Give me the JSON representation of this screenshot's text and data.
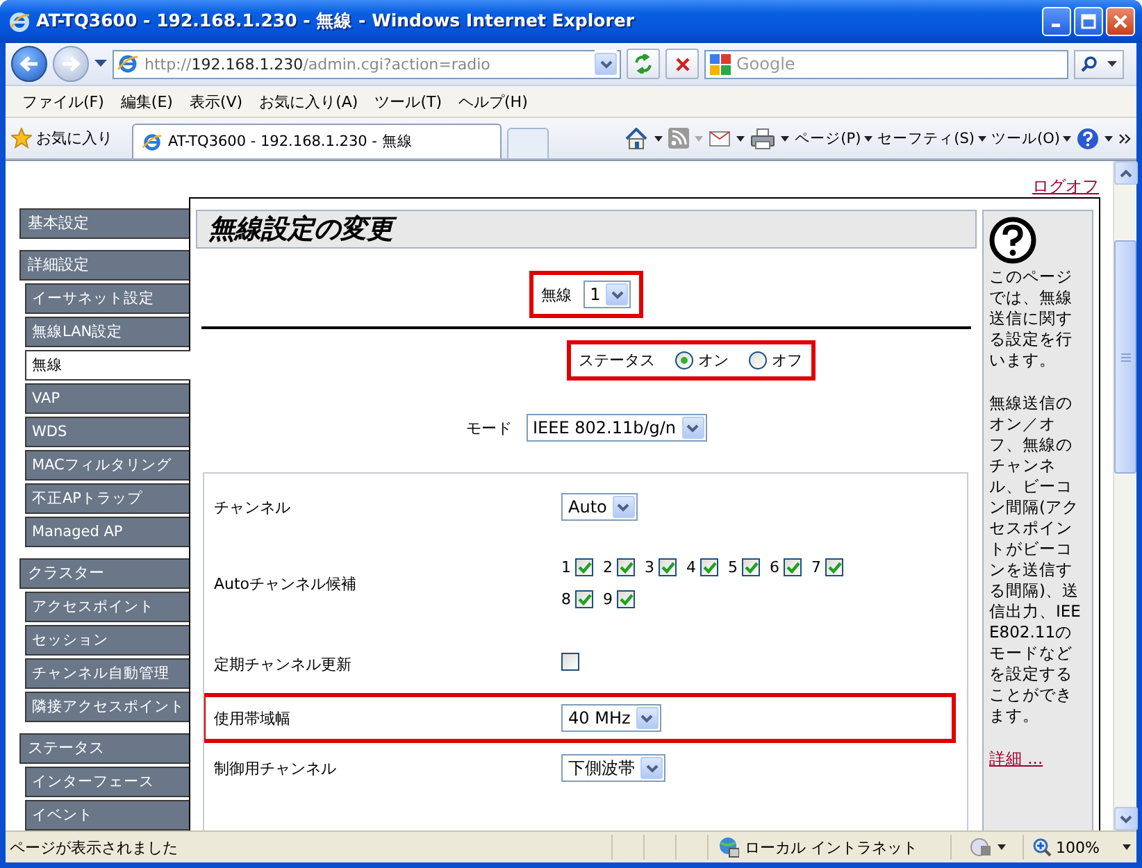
{
  "window": {
    "title": "AT-TQ3600 - 192.168.1.230 - 無線 - Windows Internet Explorer"
  },
  "address_bar": {
    "scheme": "http://",
    "host": "192.168.1.230",
    "path": "/admin.cgi?action=radio"
  },
  "search": {
    "placeholder": "Google"
  },
  "menu": [
    "ファイル(F)",
    "編集(E)",
    "表示(V)",
    "お気に入り(A)",
    "ツール(T)",
    "ヘルプ(H)"
  ],
  "favorites": {
    "label": "お気に入り"
  },
  "tabs": [
    {
      "label": "AT-TQ3600 - 192.168.1.230 - 無線",
      "selected": true
    }
  ],
  "command_bar": [
    "ページ(P)",
    "セーフティ(S)",
    "ツール(O)"
  ],
  "logoff": "ログオフ",
  "sidebar": {
    "groups": [
      {
        "label": "基本設定"
      },
      {
        "label": "詳細設定",
        "children": [
          {
            "label": "イーサネット設定",
            "selected": false
          },
          {
            "label": "無線LAN設定",
            "selected": false
          },
          {
            "label": "無線",
            "selected": true
          },
          {
            "label": "VAP",
            "selected": false
          },
          {
            "label": "WDS",
            "selected": false
          },
          {
            "label": "MACフィルタリング",
            "selected": false
          },
          {
            "label": "不正APトラップ",
            "selected": false
          },
          {
            "label": "Managed AP",
            "selected": false
          }
        ]
      },
      {
        "label": "クラスター",
        "children": [
          {
            "label": "アクセスポイント",
            "selected": false
          },
          {
            "label": "セッション",
            "selected": false
          },
          {
            "label": "チャンネル自動管理",
            "selected": false
          },
          {
            "label": "隣接アクセスポイント",
            "selected": false
          }
        ]
      },
      {
        "label": "ステータス",
        "children": [
          {
            "label": "インターフェース",
            "selected": false
          },
          {
            "label": "イベント",
            "selected": false
          }
        ]
      }
    ]
  },
  "page": {
    "title": "無線設定の変更",
    "radio": {
      "label": "無線",
      "value": "1",
      "highlighted": true
    },
    "status": {
      "label": "ステータス",
      "highlighted": true,
      "options": [
        {
          "label": "オン",
          "selected": true
        },
        {
          "label": "オフ",
          "selected": false
        }
      ]
    },
    "mode": {
      "label": "モード",
      "value": "IEEE 802.11b/g/n"
    },
    "settings": [
      {
        "kind": "select",
        "label": "チャンネル",
        "value": "Auto",
        "highlighted": false
      },
      {
        "kind": "checkboxes",
        "label": "Autoチャンネル候補",
        "highlighted": false,
        "options": [
          {
            "label": "1",
            "checked": true
          },
          {
            "label": "2",
            "checked": true
          },
          {
            "label": "3",
            "checked": true
          },
          {
            "label": "4",
            "checked": true
          },
          {
            "label": "5",
            "checked": true
          },
          {
            "label": "6",
            "checked": true
          },
          {
            "label": "7",
            "checked": true
          },
          {
            "label": "8",
            "checked": true
          },
          {
            "label": "9",
            "checked": true
          }
        ]
      },
      {
        "kind": "checkbox",
        "label": "定期チャンネル更新",
        "checked": false,
        "highlighted": false
      },
      {
        "kind": "select",
        "label": "使用帯域幅",
        "value": "40 MHz",
        "highlighted": true
      },
      {
        "kind": "select",
        "label": "制御用チャンネル",
        "value": "下側波帯",
        "highlighted": false
      }
    ]
  },
  "help": {
    "paragraphs": [
      "このページでは、無線送信に関する設定を行います。",
      "無線送信のオン／オフ、無線のチャンネル、ビーコン間隔(アクセスポイントがビーコンを送信する間隔)、送信出力、IEEE802.11のモードなどを設定することができます。"
    ],
    "link": "詳細 ..."
  },
  "status_bar": {
    "text": "ページが表示されました",
    "zone": "ローカル イントラネット",
    "zoom": "100%"
  }
}
